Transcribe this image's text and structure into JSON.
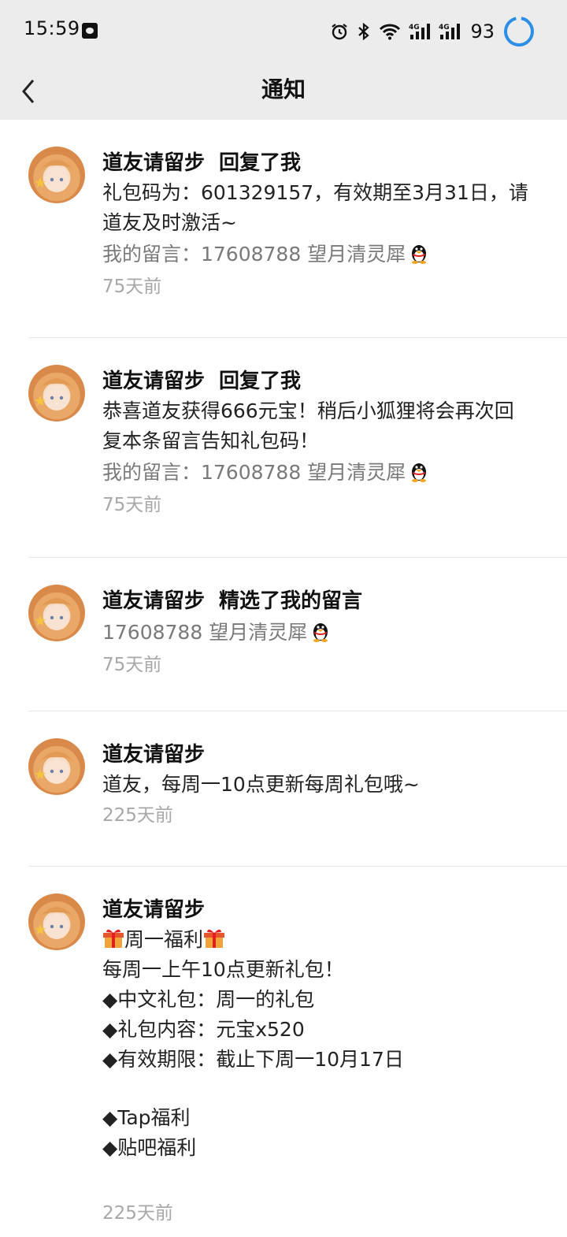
{
  "status_bar": {
    "time": "15:59",
    "battery": "93",
    "icons": [
      "alarm-icon",
      "bluetooth-icon",
      "wifi-icon",
      "signal-4g-icon",
      "signal-4g-icon",
      "battery-ring-icon"
    ]
  },
  "header": {
    "title": "通知",
    "back_icon": "chevron-left-icon"
  },
  "notifications": [
    {
      "sender": "道友请留步",
      "action": "回复了我",
      "body": [
        "礼包码为：601329157，有效期至3月31日，请",
        "道友及时激活~"
      ],
      "quote": "我的留言：17608788 望月清灵犀",
      "time": "75天前"
    },
    {
      "sender": "道友请留步",
      "action": "回复了我",
      "body": [
        "恭喜道友获得666元宝！稍后小狐狸将会再次回",
        "复本条留言告知礼包码！"
      ],
      "quote": "我的留言：17608788 望月清灵犀",
      "time": "75天前"
    },
    {
      "sender": "道友请留步",
      "action": "精选了我的留言",
      "quote": "17608788 望月清灵犀",
      "time": "75天前"
    },
    {
      "sender": "道友请留步",
      "action": "",
      "body": [
        "道友，每周一10点更新每周礼包哦~"
      ],
      "time": "225天前"
    },
    {
      "sender": "道友请留步",
      "action": "",
      "gift_heading": "周一福利",
      "body": [
        "每周一上午10点更新礼包！",
        "◆中文礼包：周一的礼包",
        "◆礼包内容：元宝x520",
        "◆有效期限：截止下周一10月17日",
        "",
        "◆Tap福利",
        "◆贴吧福利"
      ],
      "time": "225天前"
    }
  ]
}
